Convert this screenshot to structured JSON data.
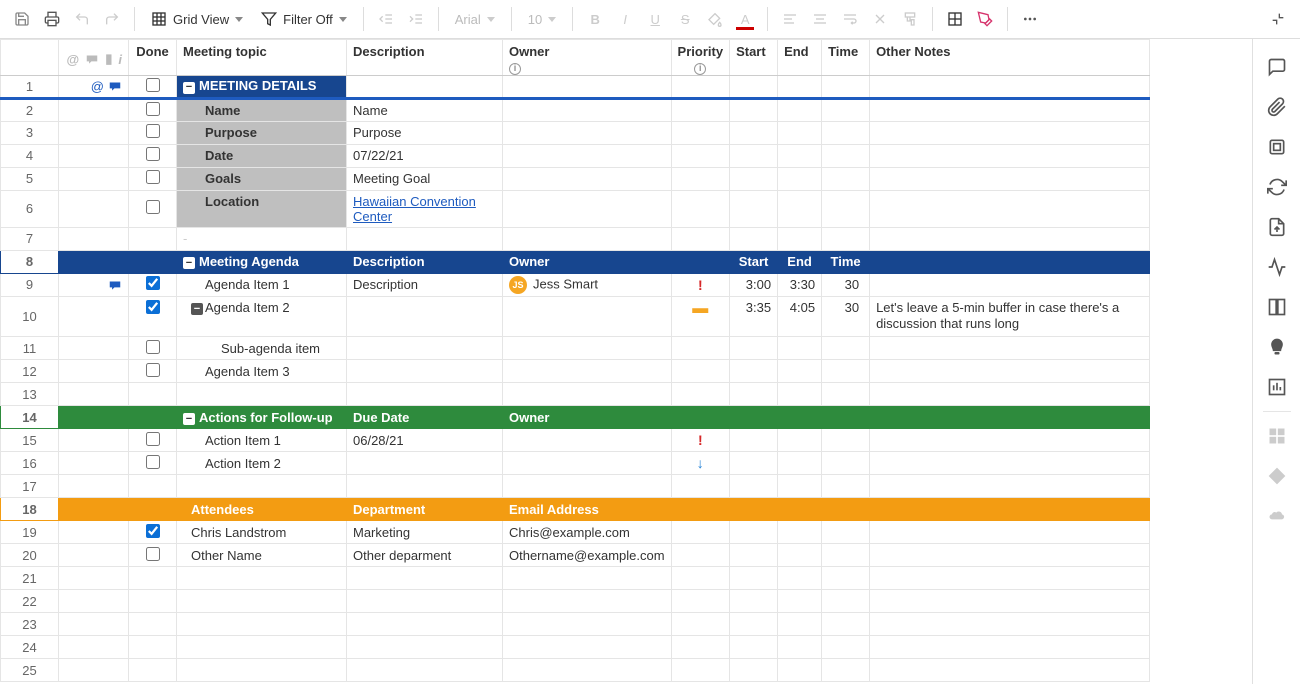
{
  "toolbar": {
    "view_label": "Grid View",
    "filter_label": "Filter Off",
    "font_name": "Arial",
    "font_size": "10"
  },
  "columns": {
    "done": "Done",
    "topic": "Meeting topic",
    "desc": "Description",
    "owner": "Owner",
    "priority": "Priority",
    "start": "Start",
    "end": "End",
    "time": "Time",
    "notes": "Other Notes"
  },
  "sections": {
    "details": {
      "title": "MEETING DETAILS",
      "rows": [
        {
          "label": "Name",
          "value": "Name"
        },
        {
          "label": "Purpose",
          "value": "Purpose"
        },
        {
          "label": "Date",
          "value": "07/22/21"
        },
        {
          "label": "Goals",
          "value": "Meeting Goal"
        },
        {
          "label": "Location",
          "value": "Hawaiian Convention Center",
          "link": true
        }
      ]
    },
    "agenda": {
      "title": "Meeting Agenda",
      "desc_header": "Description",
      "owner_header": "Owner",
      "start_header": "Start",
      "end_header": "End",
      "time_header": "Time",
      "items": [
        {
          "topic": "Agenda Item 1",
          "desc": "Description",
          "owner": "Jess Smart",
          "owner_initials": "JS",
          "priority": "high",
          "start": "3:00",
          "end": "3:30",
          "time": "30",
          "done": true,
          "comment": true
        },
        {
          "topic": "Agenda Item 2",
          "desc": "",
          "owner": "",
          "priority": "med",
          "start": "3:35",
          "end": "4:05",
          "time": "30",
          "done": true,
          "notes": "Let's leave a 5-min buffer in case there's a discussion that runs long",
          "expandable": true
        },
        {
          "topic": "Sub-agenda item",
          "indent": 2
        },
        {
          "topic": "Agenda Item 3"
        }
      ]
    },
    "actions": {
      "title": "Actions for Follow-up",
      "due_header": "Due Date",
      "owner_header": "Owner",
      "items": [
        {
          "topic": "Action Item 1",
          "due": "06/28/21",
          "priority": "high"
        },
        {
          "topic": "Action Item 2",
          "priority": "low"
        }
      ]
    },
    "attendees": {
      "title": "Attendees",
      "dept_header": "Department",
      "email_header": "Email Address",
      "items": [
        {
          "name": "Chris Landstrom",
          "dept": "Marketing",
          "email": "Chris@example.com",
          "done": true
        },
        {
          "name": "Other Name",
          "dept": "Other deparment",
          "email": "Othername@example.com"
        }
      ]
    }
  },
  "row_numbers": [
    "1",
    "2",
    "3",
    "4",
    "5",
    "6",
    "7",
    "8",
    "9",
    "10",
    "11",
    "12",
    "13",
    "14",
    "15",
    "16",
    "17",
    "18",
    "19",
    "20",
    "21",
    "22",
    "23",
    "24",
    "25"
  ]
}
